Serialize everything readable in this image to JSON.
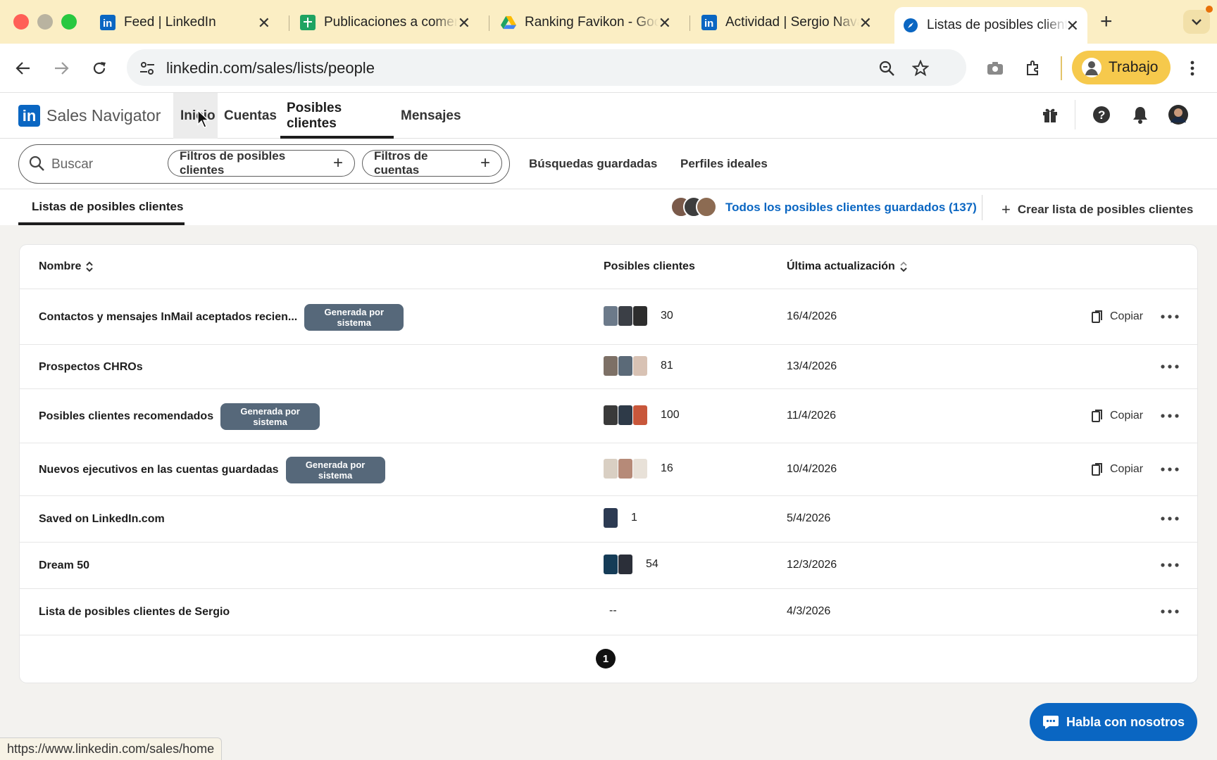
{
  "browser": {
    "tabs": [
      {
        "title": "Feed | LinkedIn",
        "icon": "linkedin-icon"
      },
      {
        "title": "Publicaciones a comentar",
        "icon": "google-sheets-icon"
      },
      {
        "title": "Ranking Favikon - Google Drive",
        "icon": "google-drive-icon"
      },
      {
        "title": "Actividad | Sergio Navarro",
        "icon": "linkedin-icon"
      },
      {
        "title": "Listas de posibles clientes",
        "icon": "sales-navigator-compass-icon"
      }
    ],
    "url": "linkedin.com/sales/lists/people",
    "profile_label": "Trabajo",
    "status_url": "https://www.linkedin.com/sales/home"
  },
  "app": {
    "brand": "Sales Navigator",
    "nav": [
      "Inicio",
      "Cuentas",
      "Posibles clientes",
      "Mensajes"
    ],
    "active_nav": "Posibles clientes"
  },
  "search": {
    "placeholder": "Buscar",
    "lead_filters": "Filtros de posibles clientes",
    "account_filters": "Filtros de cuentas",
    "saved_searches": "Búsquedas guardadas",
    "ideal_profiles": "Perfiles ideales"
  },
  "subnav": {
    "tab": "Listas de posibles clientes",
    "all_saved": "Todos los posibles clientes guardados (137)",
    "create_list": "Crear lista de posibles clientes"
  },
  "table": {
    "headers": {
      "name": "Nombre",
      "leads": "Posibles clientes",
      "updated": "Última actualización"
    },
    "badge_line1": "Generada por",
    "badge_line2": "sistema",
    "copy_label": "Copiar",
    "rows": [
      {
        "name": "Contactos y mensajes InMail aceptados recien...",
        "badge": true,
        "count": "30",
        "date": "16/4/2026",
        "copy": true
      },
      {
        "name": "Prospectos CHROs",
        "badge": false,
        "count": "81",
        "date": "13/4/2026",
        "copy": false
      },
      {
        "name": "Posibles clientes recomendados",
        "badge": true,
        "count": "100",
        "date": "11/4/2026",
        "copy": true
      },
      {
        "name": "Nuevos ejecutivos en las cuentas guardadas",
        "badge": true,
        "count": "16",
        "date": "10/4/2026",
        "copy": true
      },
      {
        "name": "Saved on LinkedIn.com",
        "badge": false,
        "count": "1",
        "date": "5/4/2026",
        "copy": false
      },
      {
        "name": "Dream 50",
        "badge": false,
        "count": "54",
        "date": "12/3/2026",
        "copy": false
      },
      {
        "name": "Lista de posibles clientes de Sergio",
        "badge": false,
        "count": "--",
        "date": "4/3/2026",
        "copy": false
      }
    ],
    "page": "1"
  },
  "chat": {
    "label": "Habla con nosotros"
  },
  "colors": {
    "brand_blue": "#0a66c2",
    "badge_gray": "#56687a",
    "tab_strip": "#fbeec4",
    "profile_chip": "#f6c94c"
  }
}
